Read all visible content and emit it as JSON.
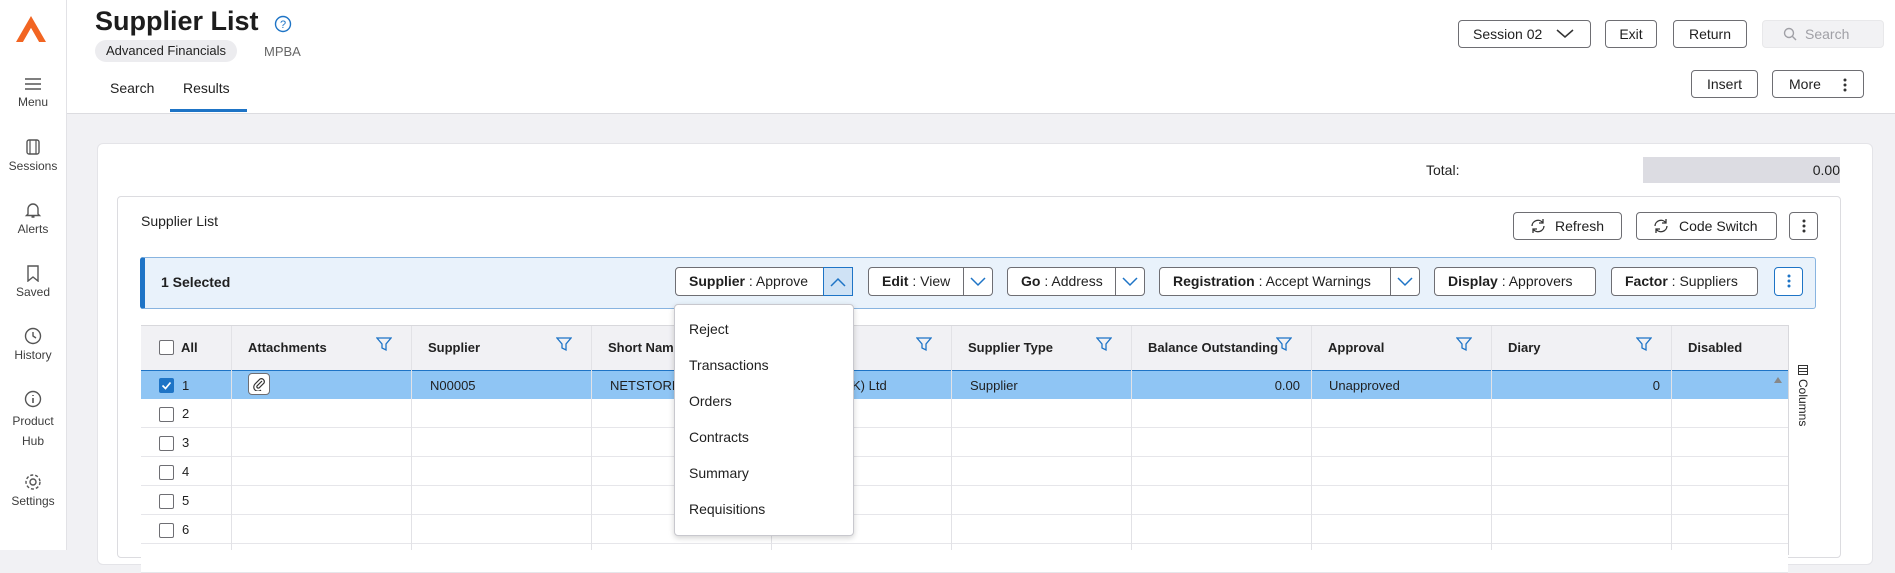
{
  "sidebar": {
    "items": [
      {
        "label": "Menu",
        "icon": "hamburger-icon"
      },
      {
        "label": "Sessions",
        "icon": "sessions-icon"
      },
      {
        "label": "Alerts",
        "icon": "bell-icon"
      },
      {
        "label": "Saved",
        "icon": "bookmark-icon"
      },
      {
        "label": "History",
        "icon": "clock-icon"
      },
      {
        "label": "Product",
        "label2": "Hub",
        "icon": "info-icon"
      },
      {
        "label": "Settings",
        "icon": "gear-icon"
      }
    ]
  },
  "header": {
    "title": "Supplier List",
    "chip": "Advanced Financials",
    "code": "MPBA",
    "tabs": [
      "Search",
      "Results"
    ],
    "session_label": "Session 02",
    "exit_label": "Exit",
    "return_label": "Return",
    "search_label": "Search",
    "insert_label": "Insert",
    "more_label": "More"
  },
  "total": {
    "label": "Total:",
    "value": "0.00"
  },
  "panel": {
    "title": "Supplier List",
    "refresh_label": "Refresh",
    "code_switch_label": "Code Switch"
  },
  "action_bar": {
    "selected_text": "1 Selected",
    "supplier": {
      "key": "Supplier",
      "value": "Approve"
    },
    "edit": {
      "key": "Edit",
      "value": "View"
    },
    "go": {
      "key": "Go",
      "value": "Address"
    },
    "registration": {
      "key": "Registration",
      "value": "Accept Warnings"
    },
    "display": {
      "key": "Display",
      "value": "Approvers"
    },
    "factor": {
      "key": "Factor",
      "value": "Suppliers"
    },
    "sep": " : "
  },
  "dropdown_menu": {
    "items": [
      "Reject",
      "Transactions",
      "Orders",
      "Contracts",
      "Summary",
      "Requisitions"
    ]
  },
  "grid": {
    "columns": [
      "All",
      "Attachments",
      "Supplier",
      "Short Name",
      "",
      "Supplier Type",
      "Balance Outstanding",
      "Approval",
      "Diary",
      "Disabled"
    ],
    "columns_panel_label": "Columns",
    "rows": [
      {
        "num": "1",
        "supplier": "N00005",
        "short_name": "NETSTORE",
        "name_tail": "K) Ltd",
        "type": "Supplier",
        "balance": "0.00",
        "approval": "Unapproved",
        "diary": "0",
        "selected": true
      },
      {
        "num": "2"
      },
      {
        "num": "3"
      },
      {
        "num": "4"
      },
      {
        "num": "5"
      },
      {
        "num": "6"
      }
    ]
  },
  "colors": {
    "accent": "#1e74c6",
    "selected_row": "#8fc5f4",
    "logo": "#f26522"
  }
}
